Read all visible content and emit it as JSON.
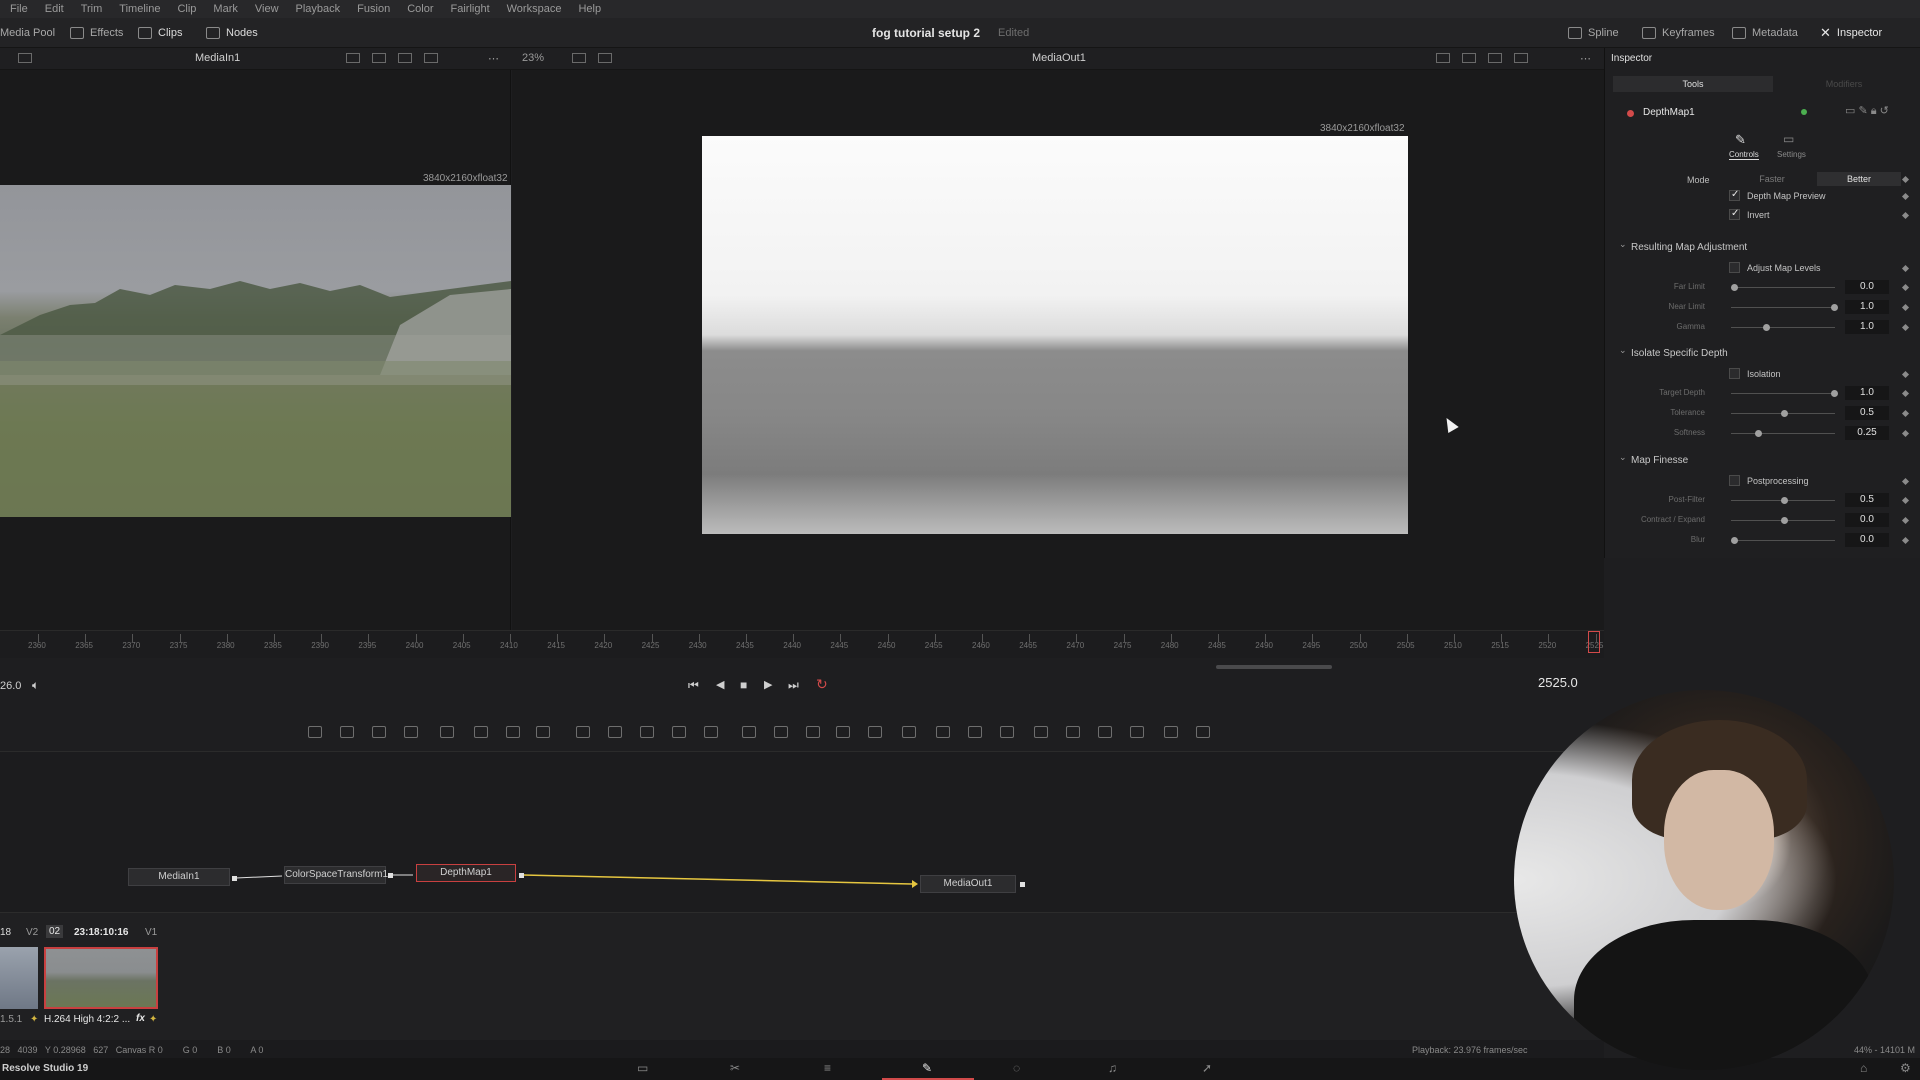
{
  "menu": [
    "File",
    "Edit",
    "Trim",
    "Timeline",
    "Clip",
    "Mark",
    "View",
    "Playback",
    "Fusion",
    "Color",
    "Fairlight",
    "Workspace",
    "Help"
  ],
  "toolbar": {
    "media_pool": "Media Pool",
    "effects": "Effects",
    "clips": "Clips",
    "nodes": "Nodes",
    "project_title": "fog tutorial setup 2",
    "edited": "Edited",
    "spline": "Spline",
    "keyframes": "Keyframes",
    "metadata": "Metadata",
    "inspector": "Inspector"
  },
  "viewer": {
    "left_title": "MediaIn1",
    "right_title": "MediaOut1",
    "zoom": "23%",
    "left_res": "3840x2160xfloat32",
    "right_res": "3840x2160xfloat32"
  },
  "ruler": {
    "labels": [
      "2360",
      "2365",
      "2370",
      "2375",
      "2380",
      "2385",
      "2390",
      "2395",
      "2400",
      "2405",
      "2410",
      "2415",
      "2420",
      "2425",
      "2430",
      "2435",
      "2440",
      "2445",
      "2450",
      "2455",
      "2460",
      "2465",
      "2470",
      "2475",
      "2480",
      "2485",
      "2490",
      "2495",
      "2500",
      "2505",
      "2510",
      "2515",
      "2520",
      "2525"
    ]
  },
  "transport": {
    "left_value": "26.0",
    "current_frame": "2525.0"
  },
  "nodes": {
    "n1": "MediaIn1",
    "n2": "ColorSpaceTransform1",
    "n3": "DepthMap1",
    "n4": "MediaOut1"
  },
  "clips": {
    "track_num": "18",
    "v2": "V2",
    "clip_num": "02",
    "timecode": "23:18:10:16",
    "v1": "V1",
    "clip_left_label": "1.5.1",
    "clip_label": "H.264 High 4:2:2 ...",
    "fx": "fx"
  },
  "status": {
    "coords": "28   4039   Y 0.28968   627   Canvas R 0        G 0        B 0        A 0",
    "playback": "Playback: 23.976 frames/sec",
    "mem": "44% - 14101 M"
  },
  "app_name": "Resolve Studio 19",
  "inspector": {
    "header": "Inspector",
    "tab_tools": "Tools",
    "tab_modifiers": "Modifiers",
    "node_name": "DepthMap1",
    "sub_controls": "Controls",
    "sub_settings": "Settings",
    "mode_label": "Mode",
    "mode_faster": "Faster",
    "mode_better": "Better",
    "depth_map_preview": "Depth Map Preview",
    "invert": "Invert",
    "sec_resulting": "Resulting Map Adjustment",
    "adjust_levels": "Adjust Map Levels",
    "far_limit": "Far Limit",
    "far_limit_val": "0.0",
    "near_limit": "Near Limit",
    "near_limit_val": "1.0",
    "gamma": "Gamma",
    "gamma_val": "1.0",
    "sec_isolate": "Isolate Specific Depth",
    "isolation": "Isolation",
    "target_depth": "Target Depth",
    "target_depth_val": "1.0",
    "tolerance": "Tolerance",
    "tolerance_val": "0.5",
    "softness": "Softness",
    "softness_val": "0.25",
    "sec_finesse": "Map Finesse",
    "postprocessing": "Postprocessing",
    "post_filter": "Post-Filter",
    "post_filter_val": "0.5",
    "contract_expand": "Contract / Expand",
    "contract_expand_val": "0.0",
    "blur": "Blur",
    "blur_val": "0.0"
  },
  "colors": {
    "accent_red": "#d24a4a",
    "link_yellow": "#e6c640",
    "node_selected": "#c84040"
  }
}
